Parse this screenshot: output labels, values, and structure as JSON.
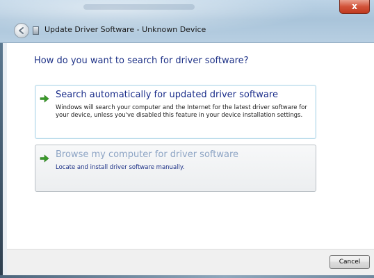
{
  "window": {
    "title": "Update Driver Software - Unknown Device",
    "close_glyph": "x"
  },
  "page": {
    "heading": "How do you want to search for driver software?"
  },
  "options": [
    {
      "title": "Search automatically for updated driver software",
      "description": "Windows will search your computer and the Internet for the latest driver software for your device, unless you've disabled this feature in your device installation settings."
    },
    {
      "title": "Browse my computer for driver software",
      "description": "Locate and install driver software manually."
    }
  ],
  "footer": {
    "cancel_label": "Cancel"
  },
  "icons": {
    "back": "back-arrow-icon",
    "close": "close-icon",
    "option_arrow": "green-arrow-icon",
    "app": "device-icon"
  },
  "colors": {
    "heading": "#1e3287",
    "option_title": "#1a2d8a",
    "option_title_disabled": "#8da4c4",
    "arrow_green": "#3a9a2a"
  }
}
